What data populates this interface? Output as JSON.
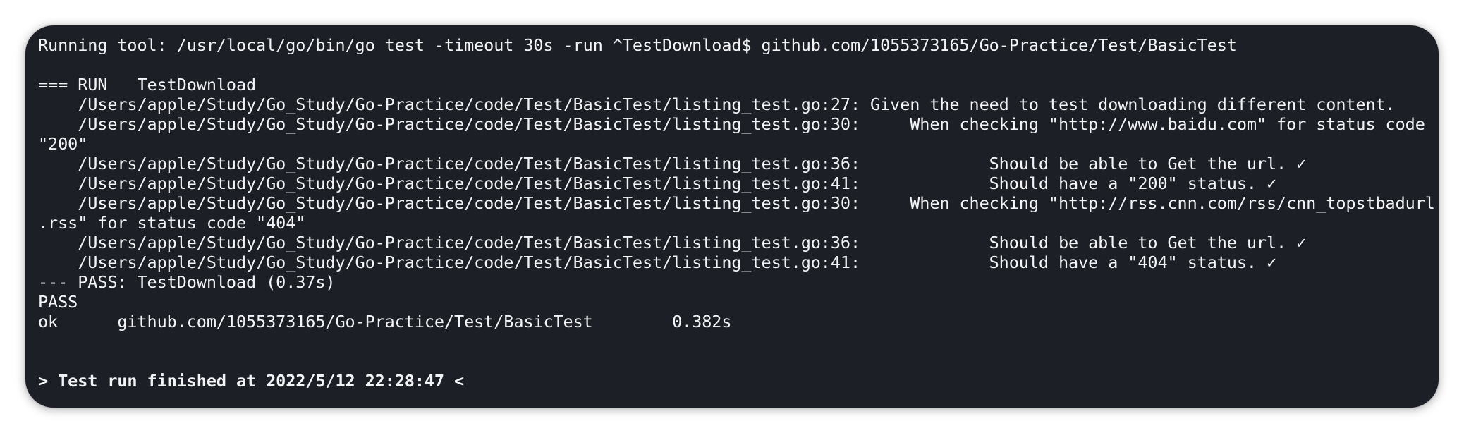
{
  "terminal": {
    "lines": [
      "Running tool: /usr/local/go/bin/go test -timeout 30s -run ^TestDownload$ github.com/1055373165/Go-Practice/Test/BasicTest",
      "",
      "=== RUN   TestDownload",
      "    /Users/apple/Study/Go_Study/Go-Practice/code/Test/BasicTest/listing_test.go:27: Given the need to test downloading different content.",
      "    /Users/apple/Study/Go_Study/Go-Practice/code/Test/BasicTest/listing_test.go:30:     When checking \"http://www.baidu.com\" for status code",
      "\"200\"",
      "    /Users/apple/Study/Go_Study/Go-Practice/code/Test/BasicTest/listing_test.go:36:             Should be able to Get the url. ✓",
      "    /Users/apple/Study/Go_Study/Go-Practice/code/Test/BasicTest/listing_test.go:41:             Should have a \"200\" status. ✓",
      "    /Users/apple/Study/Go_Study/Go-Practice/code/Test/BasicTest/listing_test.go:30:     When checking \"http://rss.cnn.com/rss/cnn_topstbadurl",
      ".rss\" for status code \"404\"",
      "    /Users/apple/Study/Go_Study/Go-Practice/code/Test/BasicTest/listing_test.go:36:             Should be able to Get the url. ✓",
      "    /Users/apple/Study/Go_Study/Go-Practice/code/Test/BasicTest/listing_test.go:41:             Should have a \"404\" status. ✓",
      "--- PASS: TestDownload (0.37s)",
      "PASS",
      "ok      github.com/1055373165/Go-Practice/Test/BasicTest        0.382s",
      "",
      "",
      "> Test run finished at 2022/5/12 22:28:47 <"
    ]
  }
}
